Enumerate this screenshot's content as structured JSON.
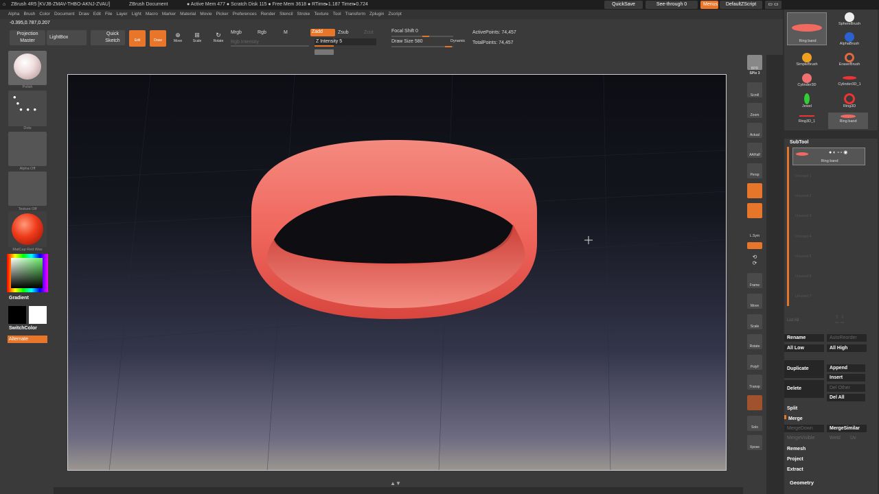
{
  "titlebar": {
    "app": "ZBrush 4R5 [KVJB-ZMAV-THBO-AKNJ-ZVAU]",
    "document": "ZBrush Document",
    "stats": "● Active Mem 477 ● Scratch Disk 115 ● Free Mem 3618 ● RTime▸1.187 Timer▸0.724",
    "quicksave": "QuickSave",
    "seethrough": "See-through  0",
    "menus": "Menus",
    "script": "DefaultZScript"
  },
  "menubar": [
    "Alpha",
    "Brush",
    "Color",
    "Document",
    "Draw",
    "Edit",
    "File",
    "Layer",
    "Light",
    "Macro",
    "Marker",
    "Material",
    "Movie",
    "Picker",
    "Preferences",
    "Render",
    "Stencil",
    "Stroke",
    "Texture",
    "Tool",
    "Transform",
    "Zplugin",
    "Zscript"
  ],
  "toolbar": {
    "coords": "-0.395,0.787,0.207",
    "projection_master": "Projection Master",
    "lightbox": "LightBox",
    "quick_sketch": "Quick Sketch",
    "edit": "Edit",
    "draw": "Draw",
    "move": "Move",
    "scale": "Scale",
    "rotate": "Rotate",
    "mrgb": "Mrgb",
    "rgb": "Rgb",
    "m": "M",
    "rgb_intensity": "Rgb Intensity",
    "zadd": "Zadd",
    "zsub": "Zsub",
    "zcut": "Zcut",
    "z_intensity": "Z Intensity 5",
    "focal_shift": "Focal Shift 0",
    "draw_size": "Draw Size 580",
    "dynamic": "Dynamic",
    "active_points": "ActivePoints: 74,457",
    "total_points": "TotalPoints: 74,457"
  },
  "leftshelf": {
    "brush": "Polish",
    "stroke": "Dots",
    "alpha": "Alpha Off",
    "texture": "Texture Off",
    "material": "MatCap Red Wax",
    "gradient": "Gradient",
    "switchcolor": "SwitchColor",
    "alternate": "Alternate"
  },
  "rightshelf": [
    "BPR",
    "SPix 3",
    "Scroll",
    "Zoom",
    "Actual",
    "AAHalf",
    "Persp",
    "Floor",
    "Local",
    "L.Sym",
    "Frame",
    "Move",
    "Scale",
    "Rotate",
    "PolyF",
    "Transp",
    "Ghost",
    "Solo",
    "Xpose"
  ],
  "panel": {
    "tools": [
      "Ring band",
      "SphereBrush",
      "SimpleBrush",
      "AlphaBrush",
      "Cylinder3D",
      "EraserBrush",
      "Jewel",
      "Cylinder3D_1",
      "Ring3D_1",
      "Ring3D",
      "Ring band"
    ],
    "subtool_title": "SubTool",
    "subtool_item": "Ring band",
    "unused": [
      "Unused 1",
      "Unused 2",
      "Unused 3",
      "Unused 4",
      "Unused 5",
      "Unused 6",
      "Unused 7"
    ],
    "list_all": "List All",
    "rename": "Rename",
    "autoreorder": "AutoReorder",
    "all_low": "All Low",
    "all_high": "All High",
    "duplicate": "Duplicate",
    "append": "Append",
    "insert": "Insert",
    "delete": "Delete",
    "del_other": "Del Other",
    "del_all": "Del All",
    "split": "Split",
    "merge": "Merge",
    "mergedown": "MergeDown",
    "mergesimilar": "MergeSimilar",
    "mergevisible": "MergeVisible",
    "weld": "Weld",
    "uv": "Uv",
    "remesh": "Remesh",
    "project": "Project",
    "extract": "Extract",
    "geometry": "Geometry"
  },
  "colors": {
    "accent": "#e8762a",
    "ring": "#f06a62",
    "bg": "#3a3a3a"
  }
}
